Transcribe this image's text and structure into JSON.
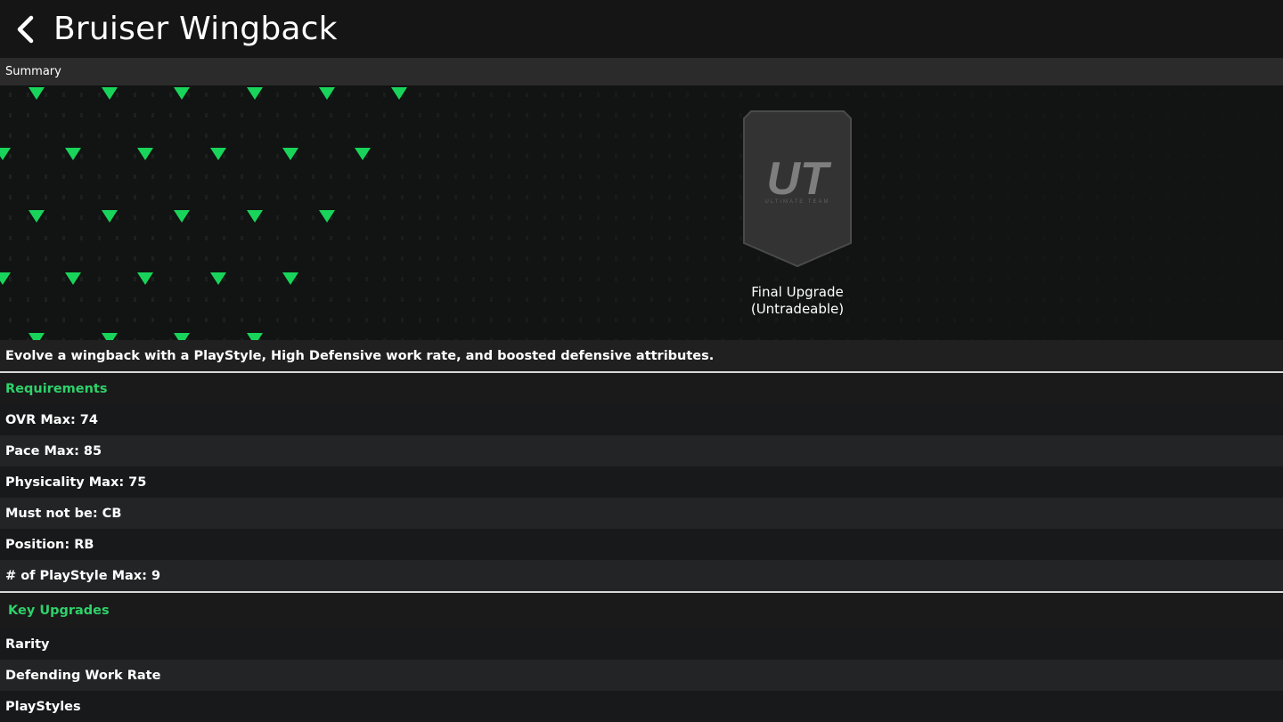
{
  "header": {
    "title": "Bruiser Wingback"
  },
  "summary": {
    "label": "Summary"
  },
  "reward": {
    "logo_text": "UT",
    "logo_subtext": "ULTIMATE TEAM",
    "label_line1": "Final Upgrade",
    "label_line2": "(Untradeable)"
  },
  "description": "Evolve a wingback with a PlayStyle, High Defensive work rate, and boosted defensive attributes.",
  "requirements": {
    "heading": "Requirements",
    "items": [
      "OVR Max: 74",
      "Pace Max: 85",
      "Physicality Max: 75",
      "Must not be: CB",
      "Position: RB",
      "# of PlayStyle Max: 9"
    ]
  },
  "key_upgrades": {
    "heading": "Key Upgrades",
    "items": [
      "Rarity",
      "Defending Work Rate",
      "PlayStyles"
    ]
  },
  "colors": {
    "accent": "#2fd16a",
    "background": "#151515"
  }
}
